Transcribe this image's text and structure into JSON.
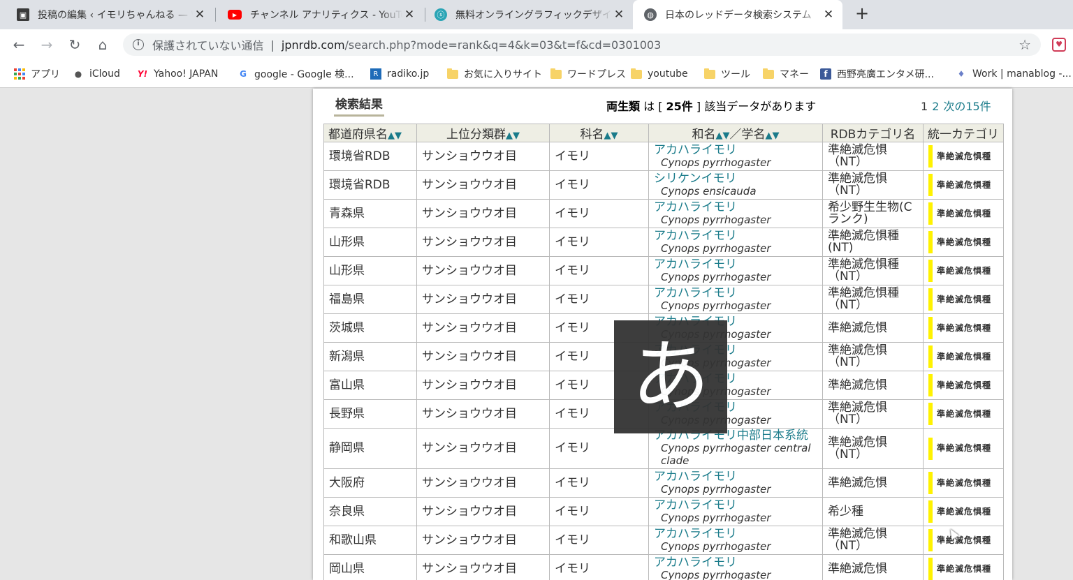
{
  "tabs": [
    {
      "title": "投稿の編集 ‹ イモリちゃんねる — Wo",
      "icon": "blog-icon",
      "color": "#3a3a3a"
    },
    {
      "title": "チャンネル アナリティクス - YouTube S",
      "icon": "youtube-icon",
      "color": "#ff0000"
    },
    {
      "title": "無料オンライングラフィックデザイナー| Z",
      "icon": "design-icon",
      "color": "#2aa4b5"
    },
    {
      "title": "日本のレッドデータ検索システム",
      "icon": "globe-icon",
      "color": "#5f6368"
    }
  ],
  "toolbar": {
    "insecure_label": "保護されていない通信",
    "separator": "|",
    "host": "jpnrdb.com",
    "path": "/search.php?mode=rank&q=4&k=03&t=f&cd=0301003"
  },
  "bookmarks": [
    {
      "label": "アプリ",
      "icon": "apps-icon"
    },
    {
      "label": "iCloud",
      "icon": "apple-icon"
    },
    {
      "label": "Yahoo! JAPAN",
      "icon": "yahoo-icon"
    },
    {
      "label": "google - Google 検...",
      "icon": "google-icon"
    },
    {
      "label": "radiko.jp",
      "icon": "radiko-icon"
    },
    {
      "label": "お気に入りサイト",
      "icon": "folder-icon"
    },
    {
      "label": "ワードプレス",
      "icon": "folder-icon"
    },
    {
      "label": "youtube",
      "icon": "folder-icon"
    },
    {
      "label": "ツール",
      "icon": "folder-icon"
    },
    {
      "label": "マネー",
      "icon": "folder-icon"
    },
    {
      "label": "西野亮廣エンタメ研...",
      "icon": "facebook-icon"
    },
    {
      "label": "Work | manablog -...",
      "icon": "manablog-icon"
    }
  ],
  "result": {
    "title": "検索結果",
    "count_group": "両生類",
    "count_mid": " は [ ",
    "count_num": "25件",
    "count_suffix": " ] 該当データがあります",
    "pager_current": "1",
    "pager_page2": "2",
    "pager_next": "次の15件"
  },
  "table": {
    "headers": {
      "pref": "都道府県名",
      "order": "上位分類群",
      "family": "科名",
      "name": "和名",
      "slash": "／学名",
      "rdb": "RDBカテゴリ名",
      "ucat": "統一カテゴリ"
    },
    "sort_arrows": "▲▼",
    "ucat_label": "準絶滅危惧種",
    "rows": [
      {
        "pref": "環境省RDB",
        "order": "サンショウウオ目",
        "family": "イモリ",
        "jname": "アカハライモリ",
        "sci": "Cynops pyrrhogaster",
        "rdb": "準絶滅危惧\n（NT）"
      },
      {
        "pref": "環境省RDB",
        "order": "サンショウウオ目",
        "family": "イモリ",
        "jname": "シリケンイモリ",
        "sci": "Cynops ensicauda",
        "rdb": "準絶滅危惧\n（NT）"
      },
      {
        "pref": "青森県",
        "order": "サンショウウオ目",
        "family": "イモリ",
        "jname": "アカハライモリ",
        "sci": "Cynops pyrrhogaster",
        "rdb": "希少野生生物(C\nランク)"
      },
      {
        "pref": "山形県",
        "order": "サンショウウオ目",
        "family": "イモリ",
        "jname": "アカハライモリ",
        "sci": "Cynops pyrrhogaster",
        "rdb": "準絶滅危惧種\n(NT)"
      },
      {
        "pref": "山形県",
        "order": "サンショウウオ目",
        "family": "イモリ",
        "jname": "アカハライモリ",
        "sci": "Cynops pyrrhogaster",
        "rdb": "準絶滅危惧種\n（NT）"
      },
      {
        "pref": "福島県",
        "order": "サンショウウオ目",
        "family": "イモリ",
        "jname": "アカハライモリ",
        "sci": "Cynops pyrrhogaster",
        "rdb": "準絶滅危惧種\n（NT）"
      },
      {
        "pref": "茨城県",
        "order": "サンショウウオ目",
        "family": "イモリ",
        "jname": "アカハライモリ",
        "sci": "Cynops pyrrhogaster",
        "rdb": "準絶滅危惧"
      },
      {
        "pref": "新潟県",
        "order": "サンショウウオ目",
        "family": "イモリ",
        "jname": "アカハライモリ",
        "sci": "Cynops pyrrhogaster",
        "rdb": "準絶滅危惧\n（NT）"
      },
      {
        "pref": "富山県",
        "order": "サンショウウオ目",
        "family": "イモリ",
        "jname": "アカハライモリ",
        "sci": "Cynops pyrrhogaster",
        "rdb": "準絶滅危惧"
      },
      {
        "pref": "長野県",
        "order": "サンショウウオ目",
        "family": "イモリ",
        "jname": "アカハライモリ",
        "sci": "Cynops pyrrhogaster",
        "rdb": "準絶滅危惧\n（NT）"
      },
      {
        "pref": "静岡県",
        "order": "サンショウウオ目",
        "family": "イモリ",
        "jname": "アカハライモリ中部日本系統",
        "sci": "Cynops pyrrhogaster central clade",
        "rdb": "準絶滅危惧\n（NT）",
        "tall": true
      },
      {
        "pref": "大阪府",
        "order": "サンショウウオ目",
        "family": "イモリ",
        "jname": "アカハライモリ",
        "sci": "Cynops pyrrhogaster",
        "rdb": "準絶滅危惧"
      },
      {
        "pref": "奈良県",
        "order": "サンショウウオ目",
        "family": "イモリ",
        "jname": "アカハライモリ",
        "sci": "Cynops pyrrhogaster",
        "rdb": "希少種"
      },
      {
        "pref": "和歌山県",
        "order": "サンショウウオ目",
        "family": "イモリ",
        "jname": "アカハライモリ",
        "sci": "Cynops pyrrhogaster",
        "rdb": "準絶滅危惧\n（NT）"
      },
      {
        "pref": "岡山県",
        "order": "サンショウウオ目",
        "family": "イモリ",
        "jname": "アカハライモリ",
        "sci": "Cynops pyrrhogaster",
        "rdb": "準絶滅危惧"
      }
    ]
  },
  "ime": {
    "char": "あ"
  },
  "colors": {
    "link": "#1a7b8a",
    "header_bg": "#eeeee4",
    "category_bar": "#fff200"
  }
}
